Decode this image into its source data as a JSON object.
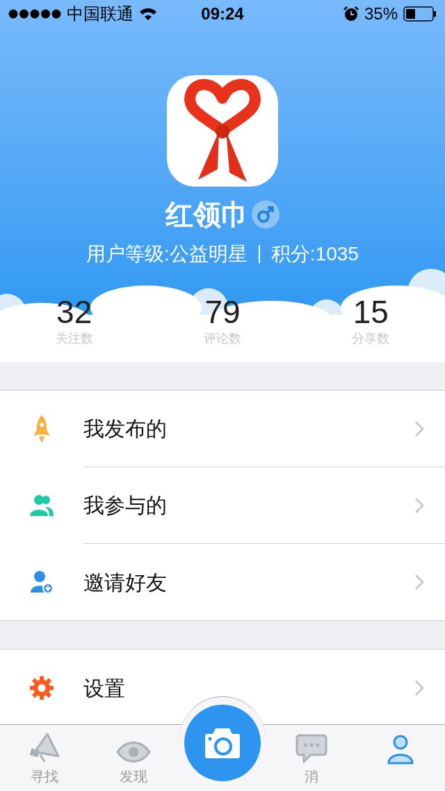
{
  "status_bar": {
    "carrier": "中国联通",
    "time": "09:24",
    "battery": "35%"
  },
  "profile": {
    "name": "红领巾",
    "male": true,
    "level_text": "用户等级:公益明星",
    "points_text": "积分:1035"
  },
  "stats": [
    {
      "value": "32",
      "label": "关注数"
    },
    {
      "value": "79",
      "label": "评论数"
    },
    {
      "value": "15",
      "label": "分享数"
    }
  ],
  "menu_groups": [
    [
      {
        "kind": "rocket",
        "label": "我发布的"
      },
      {
        "kind": "people",
        "label": "我参与的"
      },
      {
        "kind": "invite",
        "label": "邀请好友"
      }
    ],
    [
      {
        "kind": "gear",
        "label": "设置"
      }
    ]
  ],
  "tab_bar": {
    "tabs": [
      {
        "kind": "megaphone",
        "label": "寻找",
        "selected": false
      },
      {
        "kind": "eye",
        "label": "发现",
        "selected": false
      },
      {
        "kind": "camera",
        "selected": false
      },
      {
        "kind": "chat",
        "label": "消",
        "selected": false
      },
      {
        "kind": "person",
        "selected": true
      }
    ]
  }
}
